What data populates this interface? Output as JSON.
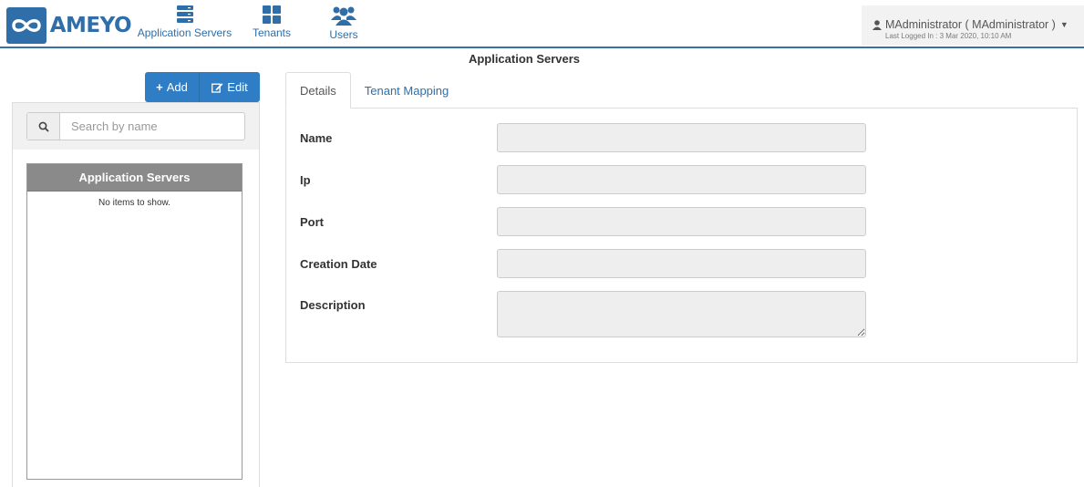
{
  "header": {
    "logo_text": "AMEYO",
    "nav": [
      {
        "label": "Application Servers",
        "icon": "server-icon"
      },
      {
        "label": "Tenants",
        "icon": "grid-icon"
      },
      {
        "label": "Users",
        "icon": "users-icon"
      }
    ],
    "user": {
      "name": "MAdministrator ( MAdministrator )",
      "last_login": "Last Logged In : 3 Mar 2020, 10:10 AM"
    },
    "accent_color": "#2f6ea8"
  },
  "page_title": "Application Servers",
  "toolbar": {
    "add_label": "Add",
    "edit_label": "Edit"
  },
  "sidebar": {
    "search_placeholder": "Search by name",
    "list_header": "Application Servers",
    "empty_text": "No items to show."
  },
  "tabs": [
    {
      "label": "Details",
      "active": true
    },
    {
      "label": "Tenant Mapping",
      "active": false
    }
  ],
  "form": {
    "fields": [
      {
        "label": "Name",
        "value": ""
      },
      {
        "label": "Ip",
        "value": ""
      },
      {
        "label": "Port",
        "value": ""
      },
      {
        "label": "Creation Date",
        "value": ""
      },
      {
        "label": "Description",
        "value": ""
      }
    ]
  }
}
